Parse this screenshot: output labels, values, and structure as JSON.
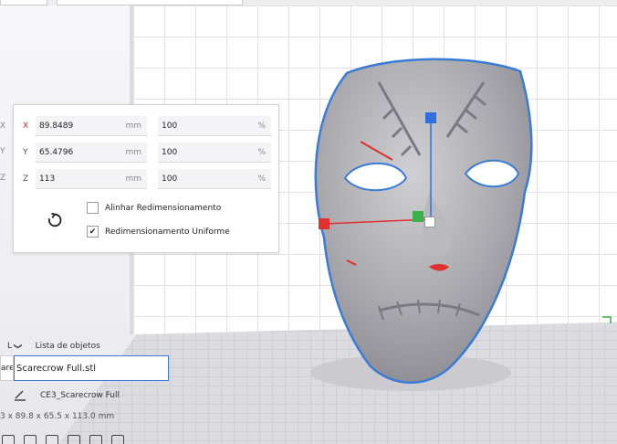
{
  "scale_panel": {
    "x": {
      "label": "X",
      "mm": "89.8489",
      "pct": "100"
    },
    "y": {
      "label": "Y",
      "mm": "65.4796",
      "pct": "100"
    },
    "z": {
      "label": "Z",
      "mm": "113",
      "pct": "100"
    },
    "unit_mm": "mm",
    "unit_pct": "%",
    "snap_scaling_label": "Alinhar Redimensionamento",
    "snap_scaling_checked": false,
    "uniform_scaling_label": "Redimensionamento Uniforme",
    "uniform_scaling_checked": true,
    "check_mark": "✔",
    "edge_labels": [
      "X",
      "Y",
      "Z"
    ]
  },
  "object_list": {
    "collapse_prefix": "L",
    "dropdown_chevron": "❯",
    "title": "Lista de objetos",
    "name_prefix": "are",
    "name_value": "Scarecrow Full.stl",
    "items": [
      {
        "label": "CE3_Scarecrow Full"
      }
    ],
    "dimensions": "3 x 89.8 x 65.5 x 113.0 mm"
  },
  "icons": {
    "reset": "reset-icon",
    "edit": "pencil-icon"
  },
  "colors": {
    "accent": "#3a7bd5",
    "axis_x": "#e03030",
    "axis_y": "#3cb04a",
    "axis_z": "#2f6fdc",
    "model": "#a8a8ac"
  }
}
